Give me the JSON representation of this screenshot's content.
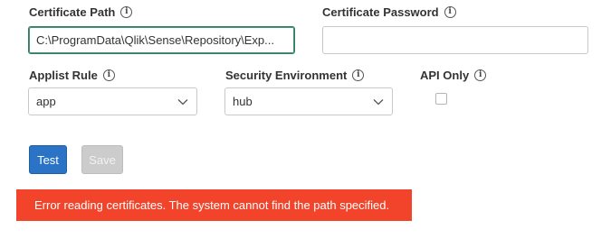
{
  "fields": {
    "certificate_path": {
      "label": "Certificate Path",
      "value": "C:\\ProgramData\\Qlik\\Sense\\Repository\\Exp..."
    },
    "certificate_password": {
      "label": "Certificate Password",
      "value": ""
    },
    "applist_rule": {
      "label": "Applist Rule",
      "selected": "app"
    },
    "security_environment": {
      "label": "Security Environment",
      "selected": "hub"
    },
    "api_only": {
      "label": "API Only",
      "checked": false
    }
  },
  "icons": {
    "info": "info-icon",
    "info_glyph": "i",
    "chevron": "chevron-down-icon"
  },
  "buttons": {
    "test_label": "Test",
    "save_label": "Save"
  },
  "error": {
    "message": "Error reading certificates. The system cannot find the path specified."
  },
  "colors": {
    "primary_button": "#2a73c5",
    "error_banner": "#f1442b",
    "focus_border": "#2e7d67",
    "disabled_button": "#cccccc"
  }
}
